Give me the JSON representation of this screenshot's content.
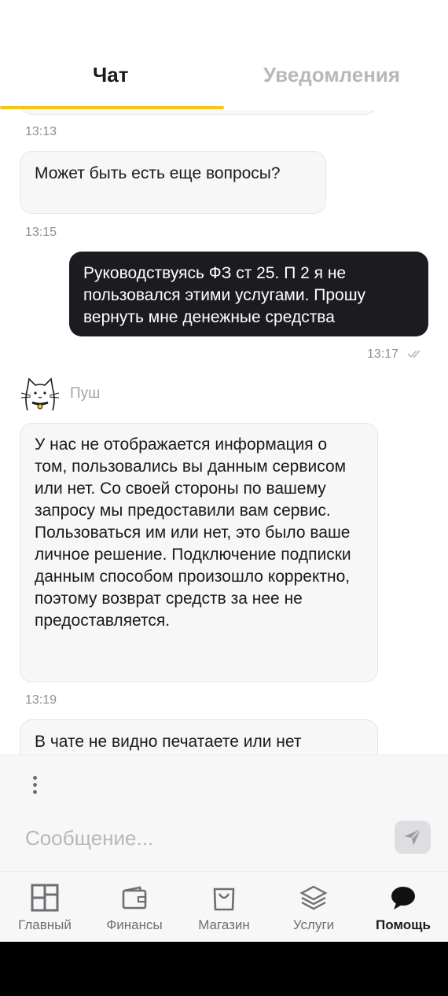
{
  "tabs": {
    "chat": "Чат",
    "notifications": "Уведомления"
  },
  "messages": {
    "m1": {
      "time": "13:13",
      "text": "Может быть есть еще вопросы?"
    },
    "m2": {
      "time": "13:15",
      "text": "Руководствуясь ФЗ ст 25. П 2 я не пользовался этими услугами. Прошу вернуть мне денежные средства",
      "sent_time": "13:17",
      "status_icon": "double-check-icon"
    },
    "sender": {
      "name": "Пуш",
      "avatar_icon": "cat-avatar-icon"
    },
    "m3": {
      "text": "У нас не отображается информация о том, пользовались вы данным сервисом или нет. Со своей стороны по вашему запросу мы предоставили вам сервис. Пользоваться им или нет, это было ваше личное решение. Подключение подписки данным способом произошло корректно, поэтому возврат средств за нее не предоставляется."
    },
    "m4": {
      "time": "13:19",
      "text": "В чате не видно печатаете или нет"
    }
  },
  "composer": {
    "placeholder": "Сообщение...",
    "menu_icon": "more-vertical-icon",
    "send_icon": "send-icon"
  },
  "nav": {
    "items": [
      {
        "label": "Главный",
        "icon": "grid-icon"
      },
      {
        "label": "Финансы",
        "icon": "wallet-icon"
      },
      {
        "label": "Магазин",
        "icon": "bag-icon"
      },
      {
        "label": "Услуги",
        "icon": "layers-icon"
      },
      {
        "label": "Помощь",
        "icon": "chat-bubble-icon",
        "active": true
      }
    ]
  },
  "colors": {
    "accent": "#f5c518",
    "outgoing_bubble": "#1c1c20",
    "incoming_bubble": "#f7f7f8"
  }
}
